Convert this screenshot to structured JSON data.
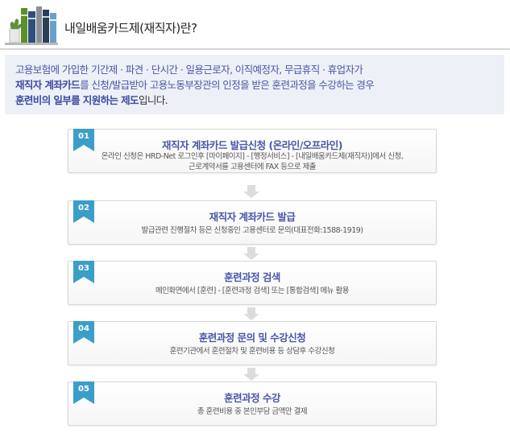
{
  "header": {
    "title": "내일배움카드제(재직자)란?"
  },
  "intro": {
    "line1": "고용보험에 가입한 기간제 · 파견 · 단시간 · 일용근로자, 이직예정자, 무급휴직 · 휴업자가",
    "line2_bold": "재직자 계좌카드",
    "line2_rest": "를 신청/발급받아 고용노동부장관의 인정을 받은 훈련과정을 수강하는 경우",
    "line3_bold": "훈련비의 일부를 지원하는 제도",
    "line3_rest": "입니다."
  },
  "steps": [
    {
      "number": "01",
      "title": "재직자 계좌카드 발급신청 (온라인/오프라인)",
      "desc_line1": "온라인 신청은 HRD-Net 로그인후 [마이페이지] - [행정서비스] - [내일배움카드제(재직자)]에서 신청,",
      "desc_line2": "근로계약서를 고용센터에 FAX 등으로 제출"
    },
    {
      "number": "02",
      "title": "재직자 계좌카드 발급",
      "desc_line1": "발급관련 진행절차 등은 신청중인 고용센터로 문의(대표전화:1588-1919)",
      "desc_line2": ""
    },
    {
      "number": "03",
      "title": "훈련과정 검색",
      "desc_line1": "메인화면에서 [훈련] - [훈련과정 검색] 또는 [통합검색] 메뉴 활용",
      "desc_line2": ""
    },
    {
      "number": "04",
      "title": "훈련과정 문의 및 수강신청",
      "desc_line1": "훈련기관에서 훈련절차 및 훈련비용 등 상담후 수강신청",
      "desc_line2": ""
    },
    {
      "number": "05",
      "title": "훈련과정 수강",
      "desc_line1": "총 훈련비용 중 본인부담 금액만 결제",
      "desc_line2": ""
    }
  ],
  "colors": {
    "accent": "#4a56a8",
    "badge": "#3a9ec9",
    "intro_bg": "#eef0f7"
  },
  "icons": {
    "header": "books-icon",
    "flow": "arrow-down-icon",
    "step_marker": "ribbon-badge-icon"
  }
}
